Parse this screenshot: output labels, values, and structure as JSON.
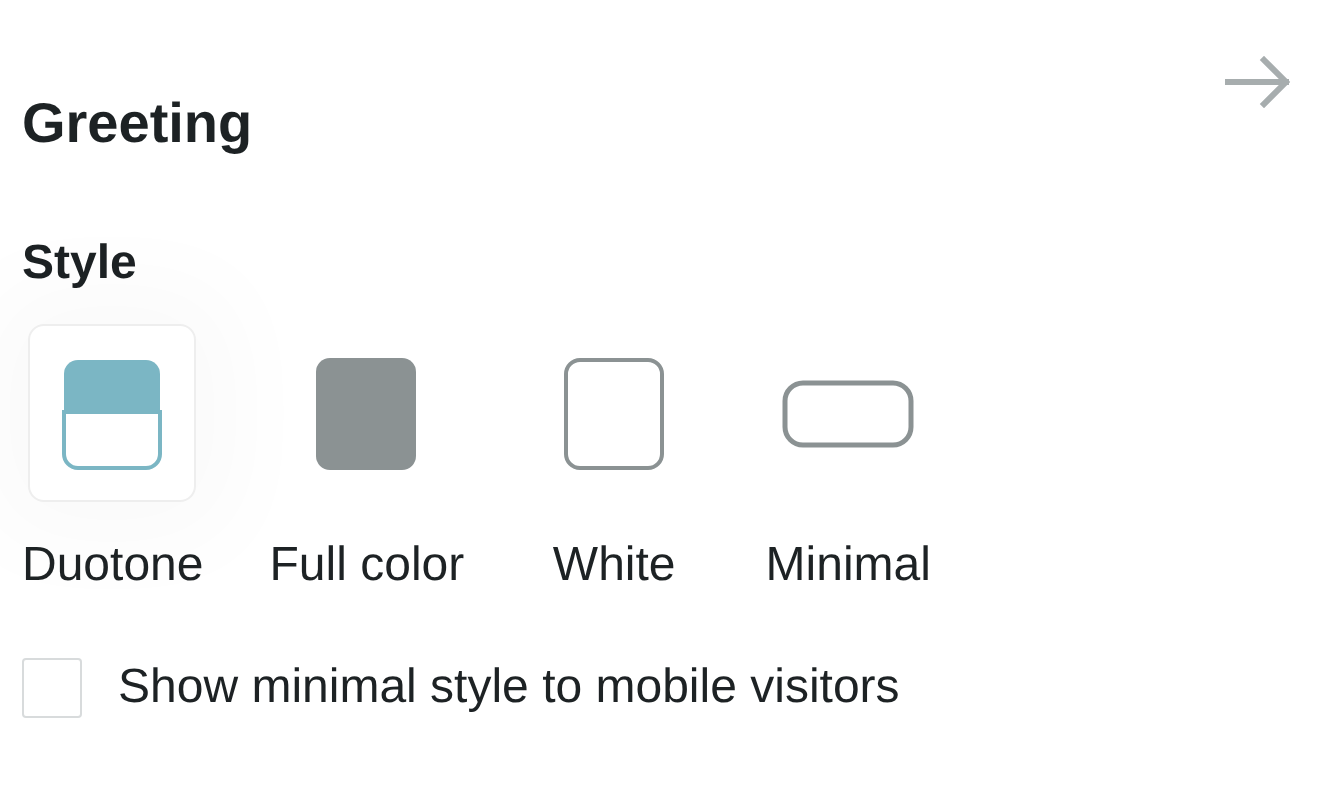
{
  "header": {
    "title": "Greeting"
  },
  "style_section": {
    "label": "Style",
    "options": [
      {
        "kind": "duotone",
        "label": "Duotone",
        "selected": true
      },
      {
        "kind": "full",
        "label": "Full color",
        "selected": false
      },
      {
        "kind": "white",
        "label": "White",
        "selected": false
      },
      {
        "kind": "minimal",
        "label": "Minimal",
        "selected": false
      }
    ]
  },
  "mobile_option": {
    "label": "Show minimal style to mobile visitors",
    "checked": false
  }
}
